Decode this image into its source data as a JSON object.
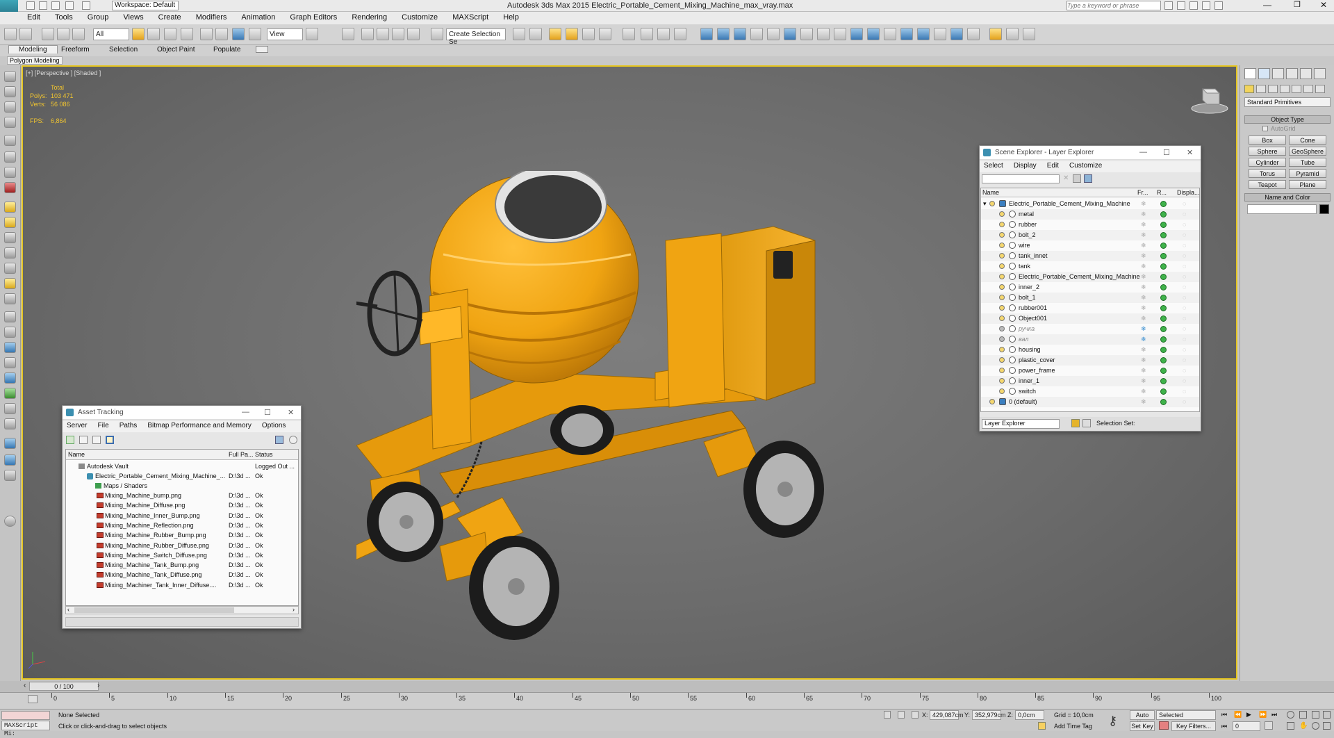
{
  "window": {
    "title": "Autodesk 3ds Max  2015    Electric_Portable_Cement_Mixing_Machine_max_vray.max",
    "workspace": "Workspace: Default",
    "search_placeholder": "Type a keyword or phrase"
  },
  "menu": [
    "Edit",
    "Tools",
    "Group",
    "Views",
    "Create",
    "Modifiers",
    "Animation",
    "Graph Editors",
    "Rendering",
    "Customize",
    "MAXScript",
    "Help"
  ],
  "toolbar": {
    "filter": "All",
    "view": "View",
    "selection_set": "Create Selection Se"
  },
  "ribbon": {
    "tabs": [
      "Modeling",
      "Freeform",
      "Selection",
      "Object Paint",
      "Populate"
    ],
    "sub": "Polygon Modeling"
  },
  "viewport": {
    "label": "[+] [Perspective ] [Shaded ]",
    "total_label": "Total",
    "polys_label": "Polys:",
    "polys": "103 471",
    "verts_label": "Verts:",
    "verts": "56 086",
    "fps_label": "FPS:",
    "fps": "6,864"
  },
  "command_panel": {
    "category": "Standard Primitives",
    "rollout1": "Object Type",
    "autogrid": "AutoGrid",
    "buttons": [
      "Box",
      "Cone",
      "Sphere",
      "GeoSphere",
      "Cylinder",
      "Tube",
      "Torus",
      "Pyramid",
      "Teapot",
      "Plane"
    ],
    "rollout2": "Name and Color"
  },
  "scene_explorer": {
    "title": "Scene Explorer - Layer Explorer",
    "menu": [
      "Select",
      "Display",
      "Edit",
      "Customize"
    ],
    "columns": [
      "Name",
      "Fr...",
      "R...",
      "Displa..."
    ],
    "root": "Electric_Portable_Cement_Mixing_Machine",
    "items": [
      "metal",
      "rubber",
      "bolt_2",
      "wire",
      "tank_innet",
      "tank",
      "Electric_Portable_Cement_Mixing_Machine",
      "inner_2",
      "bolt_1",
      "rubber001",
      "Object001",
      "ручка",
      "вал",
      "housing",
      "plastic_cover",
      "power_frame",
      "inner_1",
      "switch"
    ],
    "default_layer": "0 (default)",
    "explorer_select": "Layer Explorer",
    "selection_set": "Selection Set:"
  },
  "asset_tracking": {
    "title": "Asset Tracking",
    "menu": [
      "Server",
      "File",
      "Paths",
      "Bitmap Performance and Memory",
      "Options"
    ],
    "columns": [
      "Name",
      "Full Pa...",
      "Status"
    ],
    "vault": "Autodesk Vault",
    "vault_status": "Logged Out ...",
    "file": "Electric_Portable_Cement_Mixing_Machine_...",
    "file_path": "D:\\3d ...",
    "file_status": "Ok",
    "maps": "Maps / Shaders",
    "assets": [
      "Mixing_Machine_bump.png",
      "Mixing_Machine_Diffuse.png",
      "Mixing_Machine_Inner_Bump.png",
      "Mixing_Machine_Reflection.png",
      "Mixing_Machine_Rubber_Bump.png",
      "Mixing_Machine_Rubber_Diffuse.png",
      "Mixing_Machine_Switch_Diffuse.png",
      "Mixing_Machine_Tank_Bump.png",
      "Mixing_Machine_Tank_Diffuse.png",
      "Mixing_Machiner_Tank_Inner_Diffuse...."
    ],
    "asset_path": "D:\\3d ...",
    "asset_status": "Ok"
  },
  "timeline": {
    "frame": "0 / 100",
    "ticks": [
      "0",
      "5",
      "10",
      "15",
      "20",
      "25",
      "30",
      "35",
      "40",
      "45",
      "50",
      "55",
      "60",
      "65",
      "70",
      "75",
      "80",
      "85",
      "90",
      "95",
      "100"
    ]
  },
  "status": {
    "maxscript": "MAXScript Mi:",
    "selection": "None Selected",
    "prompt": "Click or click-and-drag to select objects",
    "x_label": "X:",
    "x": "429,087cm",
    "y_label": "Y:",
    "y": "352,979cm",
    "z_label": "Z:",
    "z": "0,0cm",
    "grid": "Grid = 10,0cm",
    "add_time_tag": "Add Time Tag",
    "auto_key": "Auto Key",
    "set_key": "Set Key",
    "key_mode": "Selected",
    "key_filters": "Key Filters...",
    "frame_field": "0"
  },
  "colors": {
    "accent": "#e4c41e",
    "mixer": "#f0a412",
    "viewport": "#6e6e6e"
  }
}
